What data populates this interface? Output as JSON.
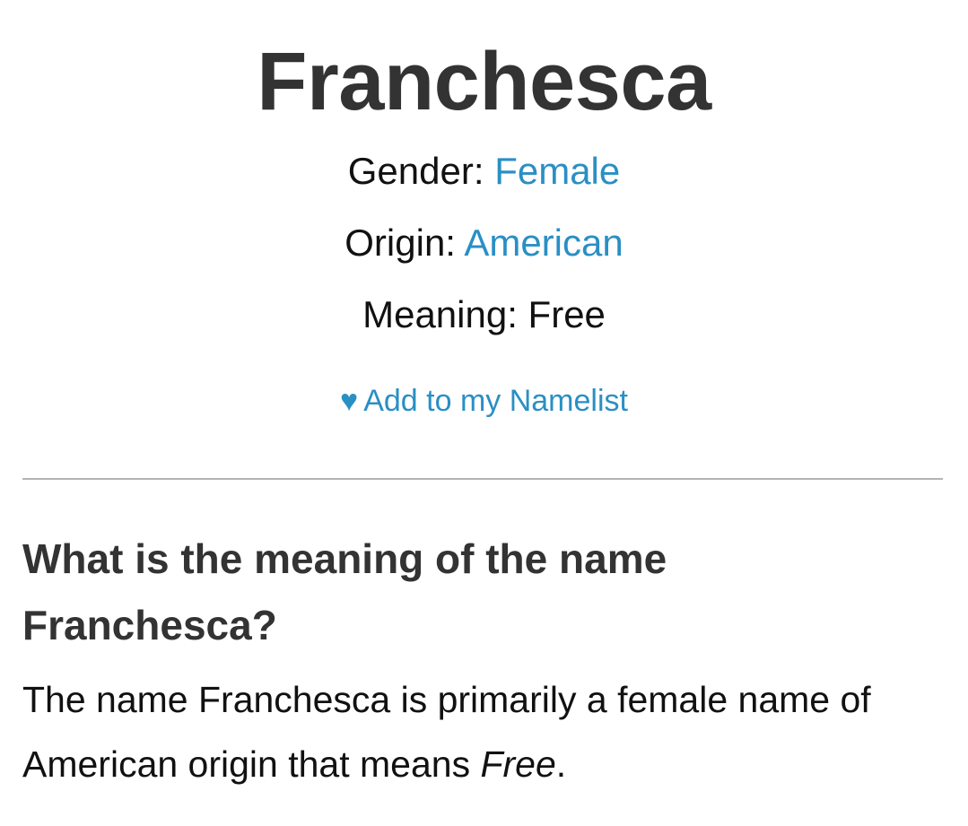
{
  "name": "Franchesca",
  "meta": {
    "gender_label": "Gender:",
    "gender_value": "Female",
    "origin_label": "Origin:",
    "origin_value": "American",
    "meaning_label": "Meaning:",
    "meaning_value": "Free"
  },
  "namelist": {
    "icon": "heart-icon",
    "label": "Add to my Namelist"
  },
  "section": {
    "heading_part1": "What is the meaning of the name",
    "heading_name": "Franchesca",
    "heading_suffix": "?",
    "body_part1": "The name Franchesca is primarily a female name of American origin that means",
    "body_emphasis": "Free",
    "body_end": "."
  },
  "colors": {
    "link": "#2a8fc4",
    "heading": "#333333",
    "text": "#111111",
    "divider": "#b4b4b4"
  }
}
